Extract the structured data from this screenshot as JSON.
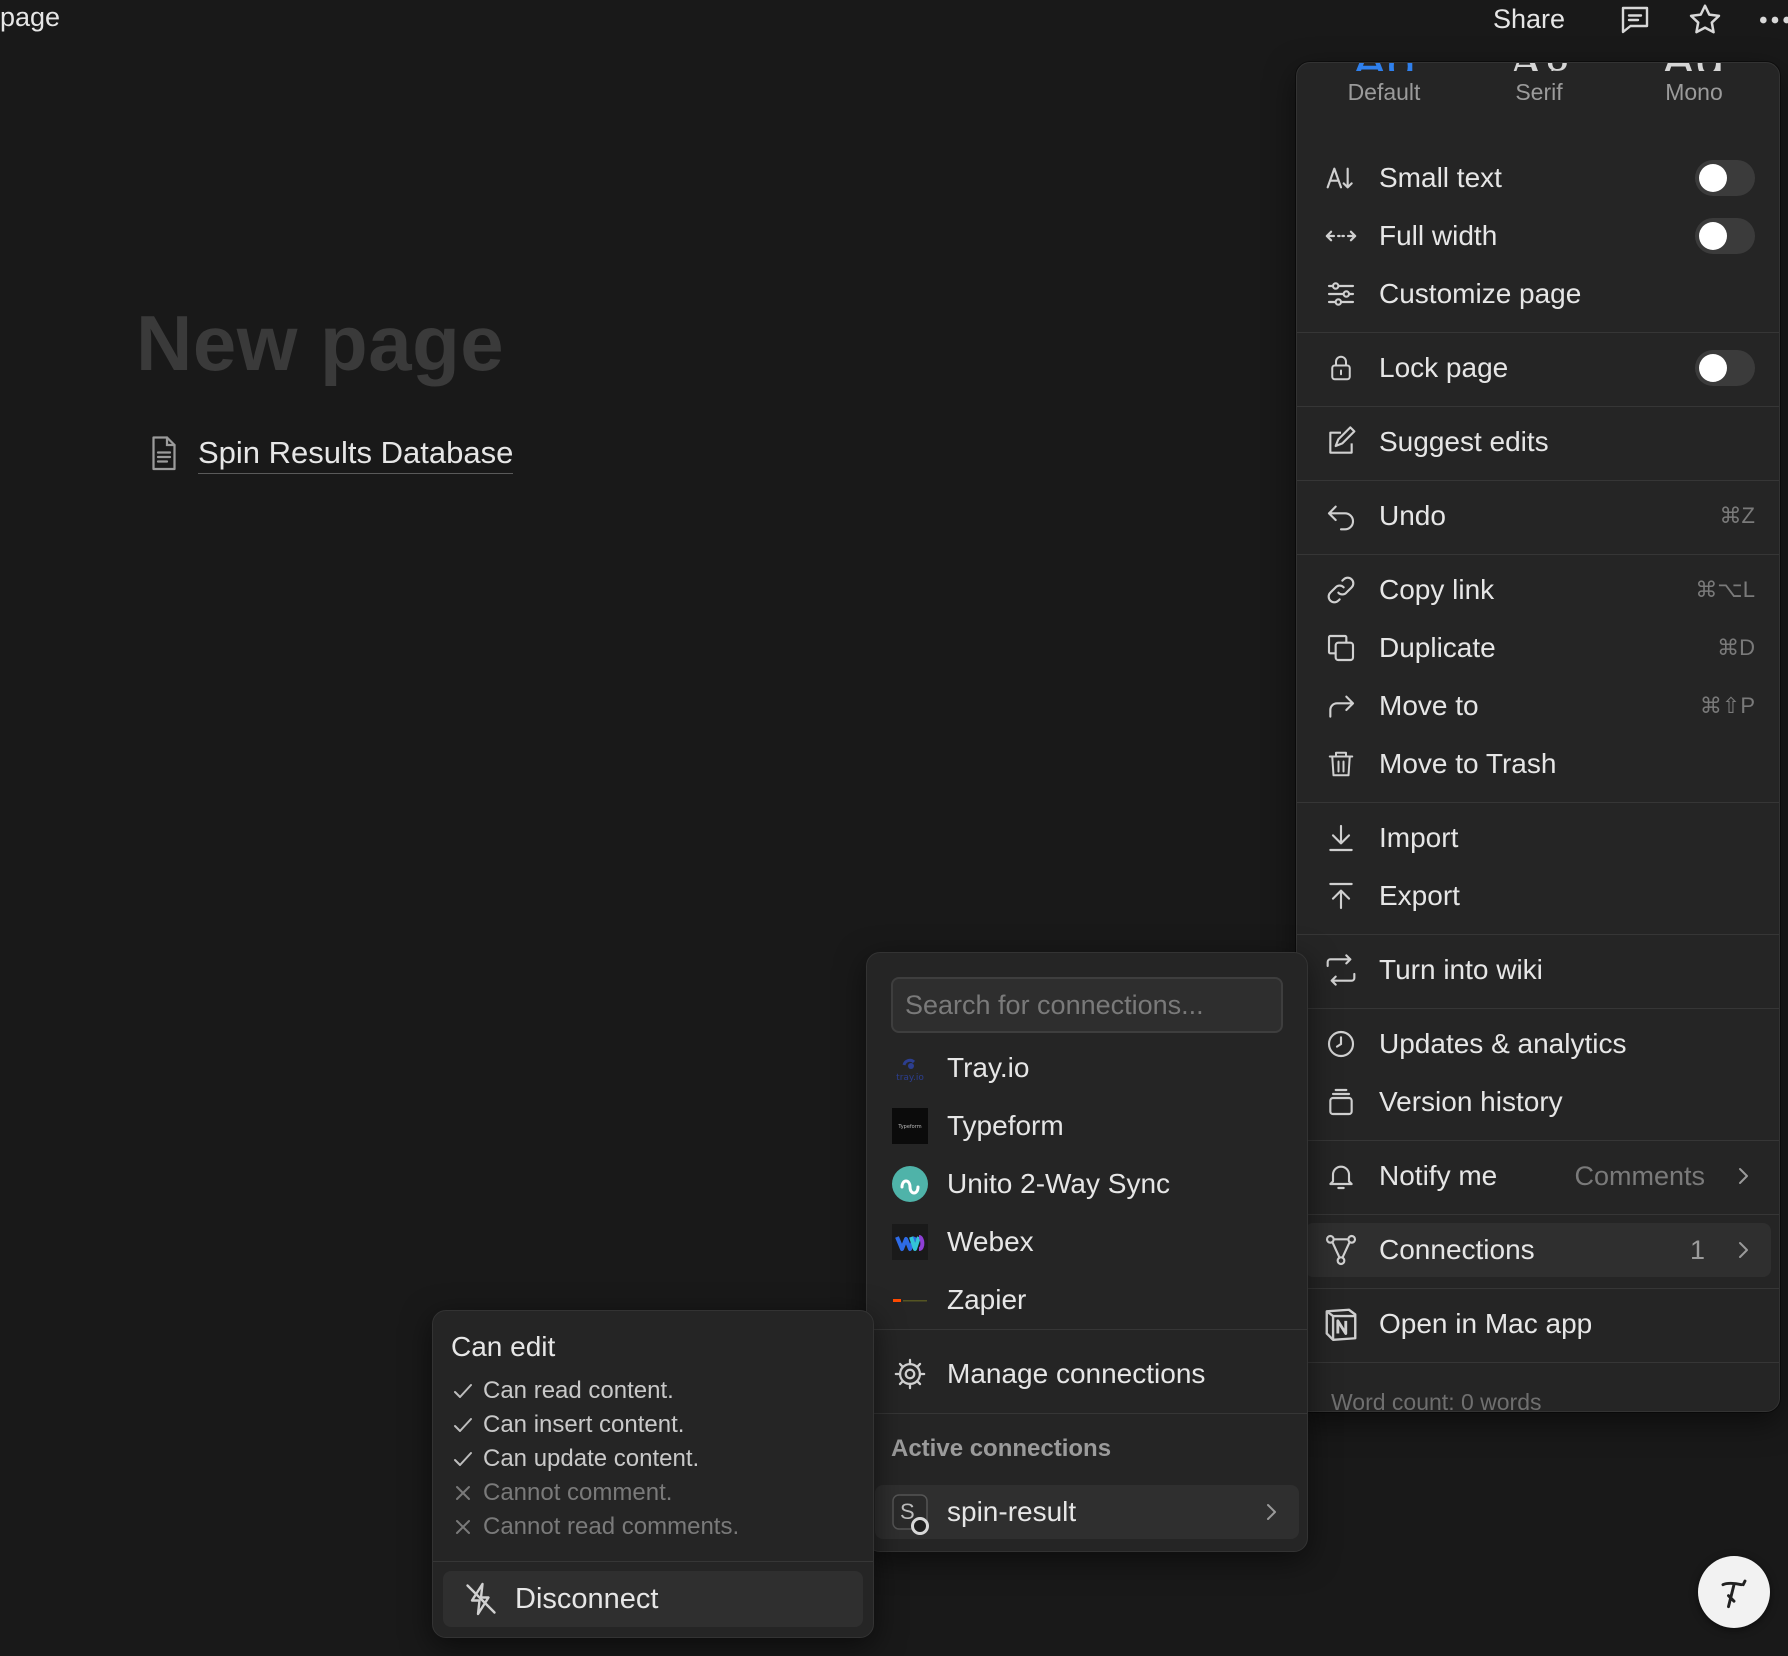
{
  "breadcrumb": {
    "label": "page"
  },
  "topbar": {
    "share_label": "Share",
    "icons": [
      "comment-icon",
      "star-icon",
      "more-icon"
    ]
  },
  "page": {
    "title": "New page",
    "link_label": "Spin Results Database"
  },
  "menu": {
    "fonts": [
      {
        "sample": "Ag",
        "label": "Default",
        "selected": true
      },
      {
        "sample": "Ag",
        "label": "Serif",
        "selected": false
      },
      {
        "sample": "Ag",
        "label": "Mono",
        "selected": false
      }
    ],
    "items": {
      "small_text": {
        "label": "Small text",
        "toggle": false
      },
      "full_width": {
        "label": "Full width",
        "toggle": false
      },
      "customize_page": {
        "label": "Customize page"
      },
      "lock_page": {
        "label": "Lock page",
        "toggle": false
      },
      "suggest_edits": {
        "label": "Suggest edits"
      },
      "undo": {
        "label": "Undo",
        "shortcut": "⌘Z"
      },
      "copy_link": {
        "label": "Copy link",
        "shortcut": "⌘⌥L"
      },
      "duplicate": {
        "label": "Duplicate",
        "shortcut": "⌘D"
      },
      "move_to": {
        "label": "Move to",
        "shortcut": "⌘⇧P"
      },
      "move_to_trash": {
        "label": "Move to Trash"
      },
      "import": {
        "label": "Import"
      },
      "export": {
        "label": "Export"
      },
      "turn_into_wiki": {
        "label": "Turn into wiki"
      },
      "updates_analytics": {
        "label": "Updates & analytics"
      },
      "version_history": {
        "label": "Version history"
      },
      "notify_me": {
        "label": "Notify me",
        "value": "Comments"
      },
      "connections": {
        "label": "Connections",
        "count": "1"
      },
      "open_mac_app": {
        "label": "Open in Mac app"
      }
    },
    "word_count": "Word count: 0 words"
  },
  "connections_panel": {
    "search_placeholder": "Search for connections...",
    "items": [
      {
        "name": "Tray.io",
        "icon": "tray-io-logo"
      },
      {
        "name": "Typeform",
        "icon": "typeform-logo"
      },
      {
        "name": "Unito 2-Way Sync",
        "icon": "unito-logo"
      },
      {
        "name": "Webex",
        "icon": "webex-logo"
      },
      {
        "name": "Zapier",
        "icon": "zapier-logo"
      }
    ],
    "manage_label": "Manage connections",
    "active_title": "Active connections",
    "active": {
      "name": "spin-result",
      "avatar_letter": "S"
    }
  },
  "permissions": {
    "title": "Can edit",
    "rows": [
      {
        "text": "Can read content.",
        "allowed": true
      },
      {
        "text": "Can insert content.",
        "allowed": true
      },
      {
        "text": "Can update content.",
        "allowed": true
      },
      {
        "text": "Cannot comment.",
        "allowed": false
      },
      {
        "text": "Cannot read comments.",
        "allowed": false
      }
    ],
    "disconnect_label": "Disconnect"
  },
  "colors": {
    "background": "#191919",
    "menu": "#252525",
    "accent": "#2f80ed",
    "unito": "#4fb3a9"
  }
}
